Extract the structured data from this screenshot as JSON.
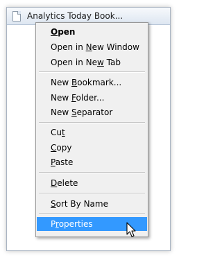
{
  "window": {
    "tab_title": "Analytics Today Book..."
  },
  "context_menu": {
    "items": [
      {
        "pre": "",
        "mnemonic": "O",
        "post": "pen"
      },
      {
        "pre": "Open in ",
        "mnemonic": "N",
        "post": "ew Window"
      },
      {
        "pre": "Open in Ne",
        "mnemonic": "w",
        "post": " Tab"
      },
      {
        "pre": "New ",
        "mnemonic": "B",
        "post": "ookmark..."
      },
      {
        "pre": "New ",
        "mnemonic": "F",
        "post": "older..."
      },
      {
        "pre": "New ",
        "mnemonic": "S",
        "post": "eparator"
      },
      {
        "pre": "Cu",
        "mnemonic": "t",
        "post": ""
      },
      {
        "pre": "",
        "mnemonic": "C",
        "post": "opy"
      },
      {
        "pre": "",
        "mnemonic": "P",
        "post": "aste"
      },
      {
        "pre": "",
        "mnemonic": "D",
        "post": "elete"
      },
      {
        "pre": "",
        "mnemonic": "S",
        "post": "ort By Name"
      },
      {
        "pre": "P",
        "mnemonic": "r",
        "post": "operties"
      }
    ],
    "selected_index": 11,
    "highlight_color": "#3399ff"
  },
  "cursor": {
    "icon": "arrow-cursor-icon"
  }
}
